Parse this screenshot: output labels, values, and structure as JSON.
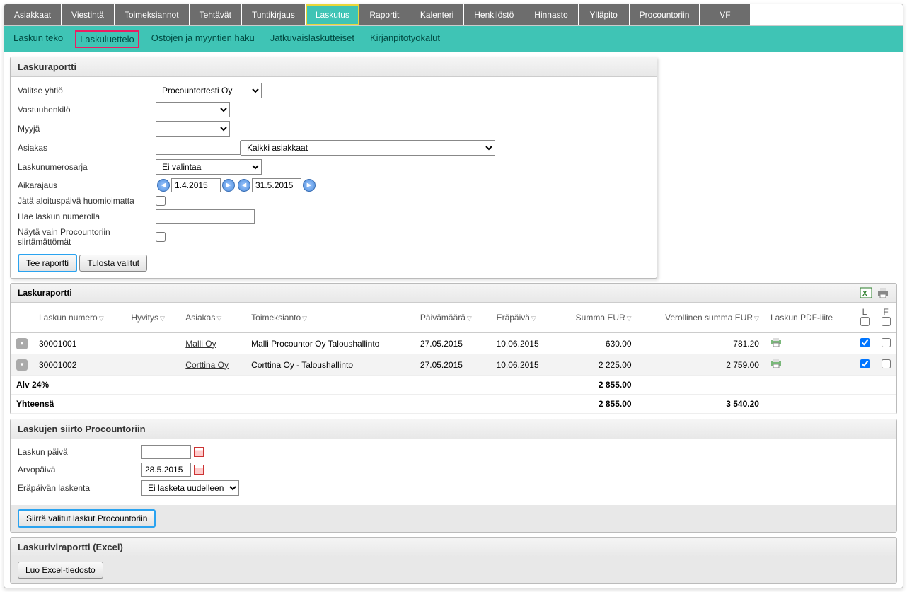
{
  "main_tabs": [
    "Asiakkaat",
    "Viestintä",
    "Toimeksiannot",
    "Tehtävät",
    "Tuntikirjaus",
    "Laskutus",
    "Raportit",
    "Kalenteri",
    "Henkilöstö",
    "Hinnasto",
    "Ylläpito",
    "Procountoriin",
    "VF"
  ],
  "active_main_tab": 5,
  "sub_tabs": [
    "Laskun teko",
    "Laskuluettelo",
    "Ostojen ja myyntien haku",
    "Jatkuvaislaskutteiset",
    "Kirjanpitotyökalut"
  ],
  "highlighted_sub_tab": 1,
  "filter": {
    "title": "Laskuraportti",
    "labels": {
      "company": "Valitse yhtiö",
      "responsible": "Vastuuhenkilö",
      "seller": "Myyjä",
      "customer": "Asiakas",
      "series": "Laskunumerosarja",
      "daterange": "Aikarajaus",
      "ignore_start": "Jätä aloituspäivä huomioimatta",
      "search_num": "Hae laskun numerolla",
      "only_untransferred": "Näytä vain Procountoriin siirtämättömät"
    },
    "company_value": "Procountortesti Oy",
    "customer_select": "Kaikki asiakkaat",
    "series_value": "Ei valintaa",
    "date_from": "1.4.2015",
    "date_to": "31.5.2015",
    "btn_run": "Tee raportti",
    "btn_print": "Tulosta valitut"
  },
  "report": {
    "title": "Laskuraportti",
    "columns": {
      "invoice_no": "Laskun numero",
      "credit": "Hyvitys",
      "customer": "Asiakas",
      "assignment": "Toimeksianto",
      "date": "Päivämäärä",
      "due": "Eräpäivä",
      "sum": "Summa EUR",
      "sum_tax": "Verollinen summa EUR",
      "pdf": "Laskun PDF-liite",
      "l": "L",
      "f": "F"
    },
    "rows": [
      {
        "no": "30001001",
        "customer": "Malli Oy",
        "assignment": "Malli Procountor Oy Taloushallinto",
        "date": "27.05.2015",
        "due": "10.06.2015",
        "sum": "630.00",
        "sum_tax": "781.20",
        "l": true,
        "f": false
      },
      {
        "no": "30001002",
        "customer": "Corttina Oy",
        "assignment": "Corttina Oy - Taloushallinto",
        "date": "27.05.2015",
        "due": "10.06.2015",
        "sum": "2 225.00",
        "sum_tax": "2 759.00",
        "l": true,
        "f": false
      }
    ],
    "vat_label": "Alv 24%",
    "vat_sum": "2 855.00",
    "total_label": "Yhteensä",
    "total_sum": "2 855.00",
    "total_tax": "3 540.20"
  },
  "transfer": {
    "title": "Laskujen siirto Procountoriin",
    "labels": {
      "invoice_date": "Laskun päivä",
      "value_date": "Arvopäivä",
      "due_calc": "Eräpäivän laskenta"
    },
    "value_date": "28.5.2015",
    "due_calc_value": "Ei lasketa uudelleen",
    "btn_transfer": "Siirrä valitut laskut Procountoriin"
  },
  "excel": {
    "title": "Laskuriviraportti (Excel)",
    "btn": "Luo Excel-tiedosto"
  }
}
